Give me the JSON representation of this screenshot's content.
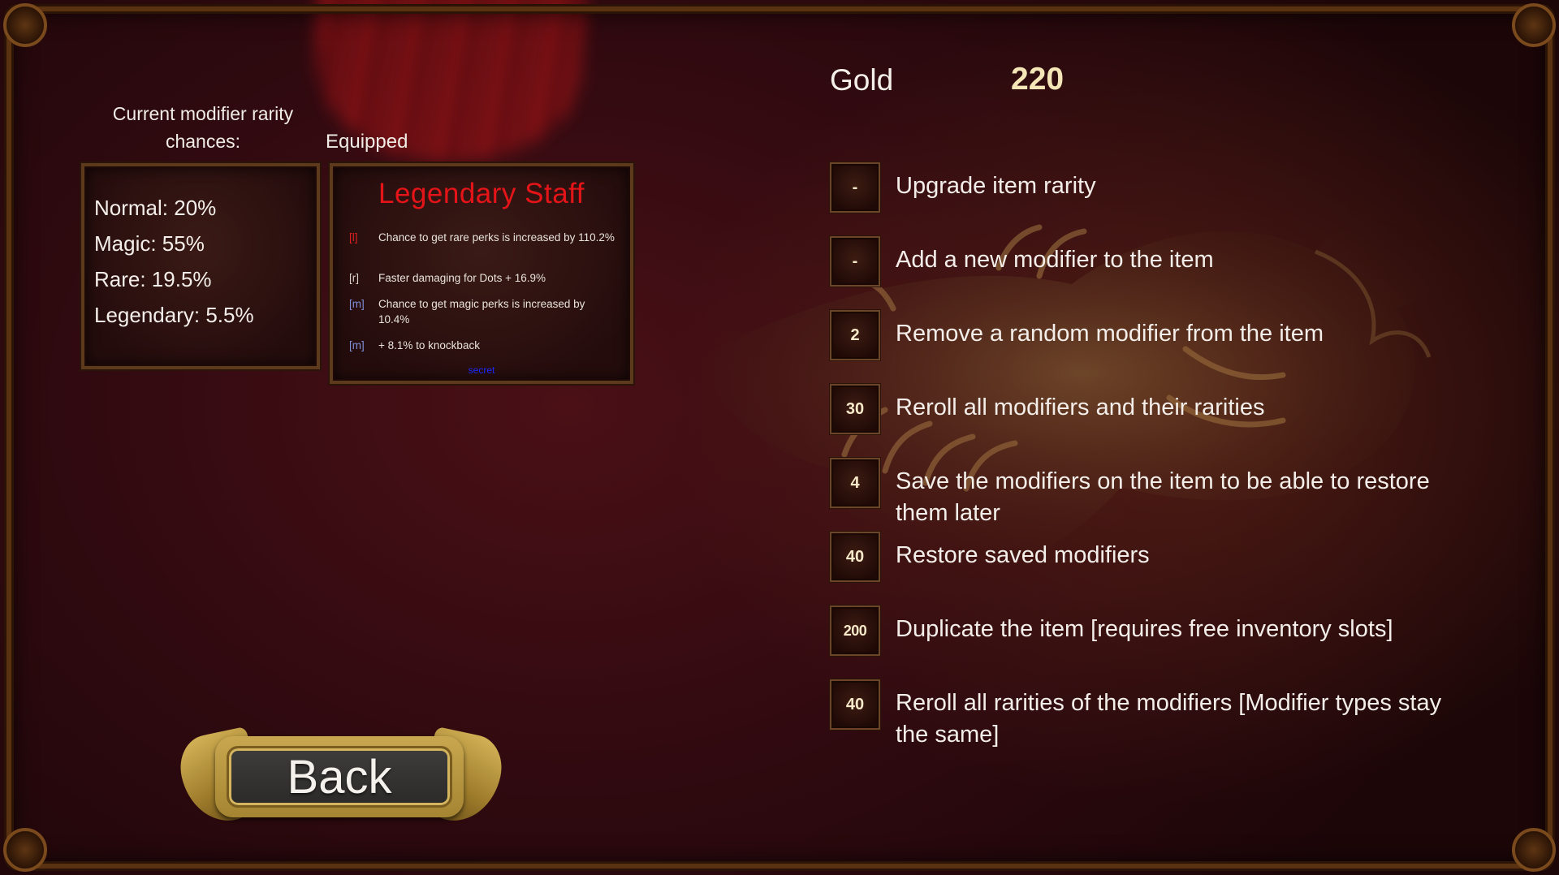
{
  "rarity_chances": {
    "title": "Current modifier rarity chances:",
    "lines": [
      "Normal: 20%",
      "Magic: 55%",
      "Rare: 19.5%",
      "Legendary: 5.5%"
    ]
  },
  "equipped": {
    "label": "Equipped",
    "item_name": "Legendary Staff",
    "perks": [
      {
        "tag": "[l]",
        "tag_color": "#e02020",
        "text": "Chance to get rare perks is increased by 110.2%"
      },
      {
        "tag": "[r]",
        "tag_color": "#d8d2c8",
        "text": "Faster damaging for Dots + 16.9%"
      },
      {
        "tag": "[m]",
        "tag_color": "#7f8fd8",
        "text": "Chance to get magic perks is increased by 10.4%"
      },
      {
        "tag": "[m]",
        "tag_color": "#7f8fd8",
        "text": "+ 8.1% to knockback"
      }
    ],
    "footer": "secret"
  },
  "gold": {
    "label": "Gold",
    "value": "220"
  },
  "actions": [
    {
      "cost": "-",
      "label": "Upgrade item rarity"
    },
    {
      "cost": "-",
      "label": "Add a new modifier to the item"
    },
    {
      "cost": "2",
      "label": "Remove a random modifier from the item"
    },
    {
      "cost": "30",
      "label": "Reroll all modifiers and their rarities"
    },
    {
      "cost": "4",
      "label": "Save the modifiers on the item to be able to restore them later"
    },
    {
      "cost": "40",
      "label": "Restore saved modifiers"
    },
    {
      "cost": "200",
      "label": "Duplicate the item [requires free inventory slots]"
    },
    {
      "cost": "40",
      "label": "Reroll all rarities of the modifiers [Modifier types stay the same]"
    }
  ],
  "back_button": {
    "label": "Back"
  },
  "colors": {
    "item_name": "#e41418",
    "gold_value": "#f5e6b8",
    "secret_text": "#1a27ff",
    "frame_gold": "#c9a750"
  }
}
